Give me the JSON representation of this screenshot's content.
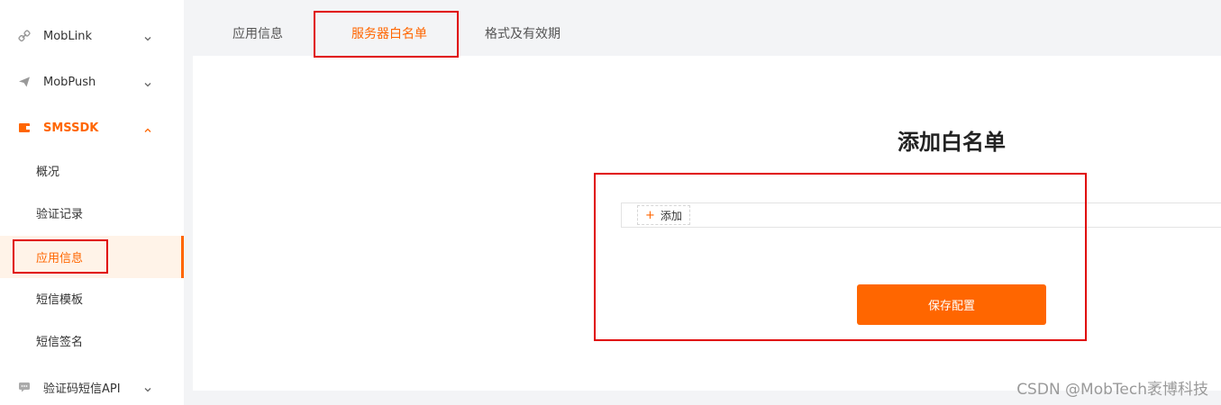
{
  "sidebar": {
    "groups": [
      {
        "label": "MobLink",
        "icon": "link-icon"
      },
      {
        "label": "MobPush",
        "icon": "send-icon"
      },
      {
        "label": "SMSSDK",
        "icon": "message-icon"
      },
      {
        "label": "验证码短信API",
        "icon": "chat-icon"
      }
    ],
    "smssdk_items": [
      {
        "label": "概况"
      },
      {
        "label": "验证记录"
      },
      {
        "label": "应用信息"
      },
      {
        "label": "短信模板"
      },
      {
        "label": "短信签名"
      }
    ]
  },
  "tabs": [
    {
      "label": "应用信息"
    },
    {
      "label": "服务器白名单"
    },
    {
      "label": "格式及有效期"
    }
  ],
  "main": {
    "heading": "添加白名单",
    "add_label": "添加",
    "add_symbol": "+",
    "save_label": "保存配置"
  },
  "watermark": "CSDN @MobTech袤博科技",
  "colors": {
    "accent": "#ff6600",
    "annotation": "#e00000",
    "selected_bg": "#fff3e8"
  }
}
